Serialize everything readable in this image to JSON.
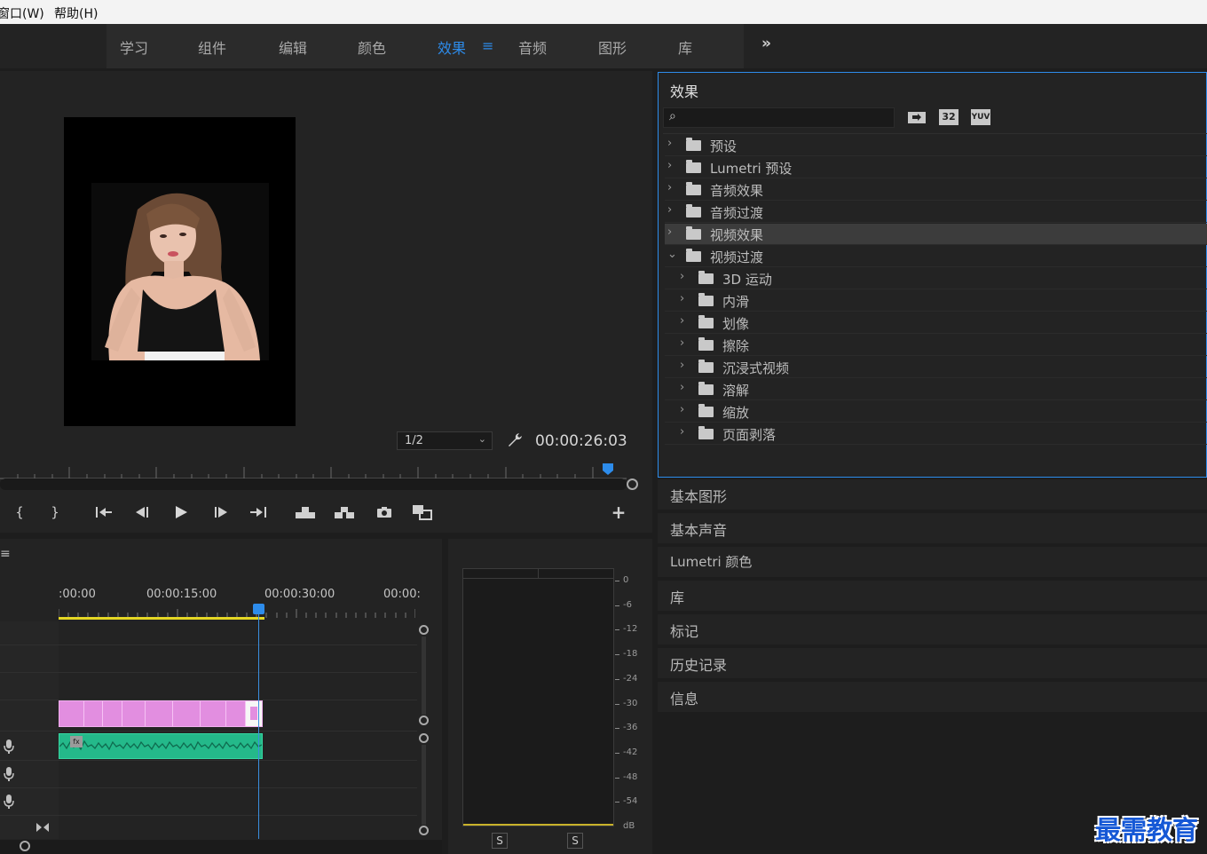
{
  "menubar": {
    "window": "窗口(W)",
    "help": "帮助(H)"
  },
  "workspaces": {
    "tabs": [
      "学习",
      "组件",
      "编辑",
      "颜色",
      "效果",
      "音频",
      "图形",
      "库"
    ],
    "active": "效果",
    "overflow_icon": "double-chevron-right-icon"
  },
  "monitor": {
    "zoom": "1/2",
    "timecode": "00:00:26:03"
  },
  "effects": {
    "title": "效果",
    "search_placeholder": "",
    "filter_icons": [
      "accelerated-effects-icon",
      "32-bit-color-icon",
      "yuv-effects-icon"
    ],
    "filter_labels": {
      "f32": "32",
      "yuv": "YUV"
    },
    "tree": [
      {
        "label": "预设",
        "level": 0,
        "expanded": false,
        "icon": "preset-folder-icon"
      },
      {
        "label": "Lumetri 预设",
        "level": 0,
        "expanded": false,
        "icon": "preset-folder-icon"
      },
      {
        "label": "音频效果",
        "level": 0,
        "expanded": false,
        "icon": "folder-icon"
      },
      {
        "label": "音频过渡",
        "level": 0,
        "expanded": false,
        "icon": "folder-icon"
      },
      {
        "label": "视频效果",
        "level": 0,
        "expanded": false,
        "icon": "folder-icon",
        "selected": true
      },
      {
        "label": "视频过渡",
        "level": 0,
        "expanded": true,
        "icon": "folder-icon"
      },
      {
        "label": "3D 运动",
        "level": 1,
        "expanded": false,
        "icon": "folder-icon"
      },
      {
        "label": "内滑",
        "level": 1,
        "expanded": false,
        "icon": "folder-icon"
      },
      {
        "label": "划像",
        "level": 1,
        "expanded": false,
        "icon": "folder-icon"
      },
      {
        "label": "擦除",
        "level": 1,
        "expanded": false,
        "icon": "folder-icon"
      },
      {
        "label": "沉浸式视频",
        "level": 1,
        "expanded": false,
        "icon": "folder-icon"
      },
      {
        "label": "溶解",
        "level": 1,
        "expanded": false,
        "icon": "folder-icon"
      },
      {
        "label": "缩放",
        "level": 1,
        "expanded": false,
        "icon": "folder-icon"
      },
      {
        "label": "页面剥落",
        "level": 1,
        "expanded": false,
        "icon": "folder-icon"
      }
    ]
  },
  "panels": [
    "基本图形",
    "基本声音",
    "Lumetri 颜色",
    "库",
    "标记",
    "历史记录",
    "信息"
  ],
  "timeline": {
    "timecodes": [
      ":00:00",
      "00:00:15:00",
      "00:00:30:00",
      "00:00:"
    ],
    "fx_label": "fx"
  },
  "audio_meter": {
    "scale": [
      "0",
      "-6",
      "-12",
      "-18",
      "-24",
      "-30",
      "-36",
      "-42",
      "-48",
      "-54",
      "dB"
    ],
    "solo": [
      "S",
      "S"
    ]
  },
  "watermark": "最需教育"
}
